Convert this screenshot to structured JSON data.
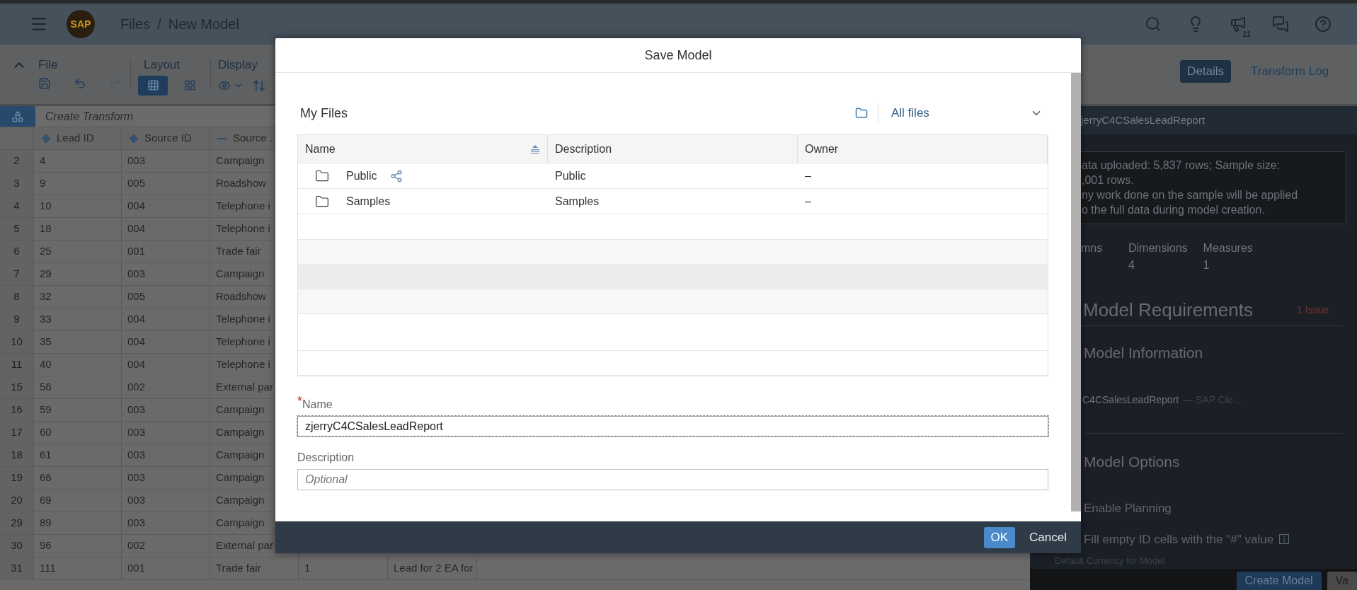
{
  "header": {
    "logo_text": "SAP",
    "breadcrumb": [
      "Files",
      "New Model"
    ],
    "separator": "/",
    "notification_count": "11"
  },
  "toolbar": {
    "groups": [
      {
        "label": "File"
      },
      {
        "label": "Layout"
      },
      {
        "label": "Display"
      }
    ],
    "layout_options": [
      {
        "selected": true
      },
      {
        "selected": false
      }
    ],
    "tabs": [
      {
        "label": "Details",
        "selected": true
      },
      {
        "label": "Transform Log",
        "selected": false
      }
    ]
  },
  "transform_bar": {
    "placeholder": "Create Transform"
  },
  "table": {
    "columns": [
      {
        "label": "Lead ID",
        "kind": "dimension"
      },
      {
        "label": "Source ID",
        "kind": "dimension"
      },
      {
        "label": "Source .",
        "kind": "attribute"
      }
    ],
    "rows": [
      {
        "row": "2",
        "cells": [
          "4",
          "003",
          "Campaign"
        ]
      },
      {
        "row": "3",
        "cells": [
          "9",
          "005",
          "Roadshow"
        ]
      },
      {
        "row": "4",
        "cells": [
          "10",
          "004",
          "Telephone i"
        ]
      },
      {
        "row": "5",
        "cells": [
          "18",
          "004",
          "Telephone i"
        ]
      },
      {
        "row": "6",
        "cells": [
          "25",
          "001",
          "Trade fair"
        ]
      },
      {
        "row": "7",
        "cells": [
          "29",
          "003",
          "Campaign"
        ]
      },
      {
        "row": "8",
        "cells": [
          "32",
          "005",
          "Roadshow"
        ]
      },
      {
        "row": "9",
        "cells": [
          "33",
          "004",
          "Telephone i"
        ]
      },
      {
        "row": "10",
        "cells": [
          "35",
          "004",
          "Telephone i"
        ]
      },
      {
        "row": "11",
        "cells": [
          "40",
          "004",
          "Telephone i"
        ]
      },
      {
        "row": "15",
        "cells": [
          "56",
          "002",
          "External par"
        ]
      },
      {
        "row": "16",
        "cells": [
          "59",
          "003",
          "Campaign"
        ]
      },
      {
        "row": "17",
        "cells": [
          "60",
          "003",
          "Campaign"
        ]
      },
      {
        "row": "18",
        "cells": [
          "61",
          "003",
          "Campaign"
        ]
      },
      {
        "row": "19",
        "cells": [
          "66",
          "003",
          "Campaign"
        ]
      },
      {
        "row": "20",
        "cells": [
          "69",
          "003",
          "Campaign"
        ]
      },
      {
        "row": "29",
        "cells": [
          "89",
          "003",
          "Campaign"
        ]
      },
      {
        "row": "30",
        "cells": [
          "96",
          "002",
          "External par"
        ]
      },
      {
        "row": "31",
        "cells": [
          "111",
          "001",
          "Trade fair",
          "1",
          "Lead for 2 EA for"
        ]
      }
    ]
  },
  "dialog": {
    "title": "Save Model",
    "section": "My Files",
    "filter": "All files",
    "columns": [
      {
        "label": "Name",
        "sorted": true
      },
      {
        "label": "Description",
        "sorted": false
      },
      {
        "label": "Owner",
        "sorted": false
      }
    ],
    "rows": [
      {
        "name": "Public",
        "description": "Public",
        "owner": "–",
        "shared": true
      },
      {
        "name": "Samples",
        "description": "Samples",
        "owner": "–",
        "shared": false
      }
    ],
    "name_field": {
      "label": "Name",
      "required": true,
      "required_mark": "*",
      "value": "zjerryC4CSalesLeadReport"
    },
    "description_field": {
      "label": "Description",
      "placeholder": "Optional"
    },
    "buttons": [
      {
        "label": "OK",
        "kind": "primary"
      },
      {
        "label": "Cancel",
        "kind": "secondary"
      }
    ]
  },
  "details": {
    "title": "jerryC4CSalesLeadReport",
    "info_lines": [
      "ata uploaded: 5,837 rows; Sample size:",
      ",001 rows.",
      "ny work done on the sample will be applied",
      "o the full data during model creation."
    ],
    "stats": [
      {
        "label": "mns"
      },
      {
        "label": "Dimensions",
        "value": "4"
      },
      {
        "label": "Measures",
        "value": "1"
      }
    ],
    "requirements": {
      "title": "Model Requirements",
      "issues": "1 Issue"
    },
    "information": {
      "title": "Model Information",
      "model_name": "C4CSalesLeadReport",
      "source": "— SAP Clo..."
    },
    "options": {
      "title": "Model Options",
      "items": [
        {
          "label": "Enable Planning",
          "info": false
        },
        {
          "label": "Fill empty ID cells with the \"#\" value",
          "info": true
        }
      ]
    },
    "currency_label": "Default Currency for Model",
    "footer_buttons": [
      {
        "label": "Create Model",
        "kind": "primary"
      },
      {
        "label": "Va",
        "kind": "secondary"
      }
    ]
  }
}
